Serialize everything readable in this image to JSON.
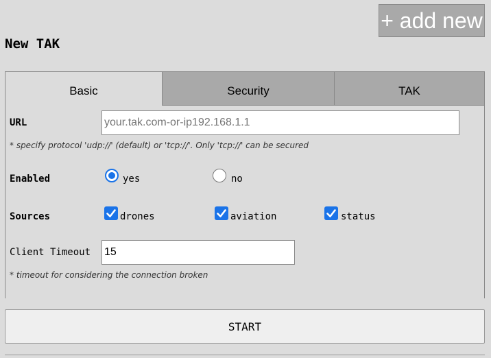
{
  "header": {
    "add_new_label": "+ add new",
    "title": "New TAK"
  },
  "tabs": [
    {
      "label": "Basic",
      "active": true
    },
    {
      "label": "Security",
      "active": false
    },
    {
      "label": "TAK",
      "active": false
    }
  ],
  "form": {
    "url": {
      "label": "URL",
      "placeholder": "your.tak.com-or-ip192.168.1.1",
      "value": "",
      "hint": "* specify protocol 'udp://' (default) or 'tcp://'. Only 'tcp://' can be secured"
    },
    "enabled": {
      "label": "Enabled",
      "options": [
        {
          "label": "yes",
          "checked": true
        },
        {
          "label": "no",
          "checked": false
        }
      ]
    },
    "sources": {
      "label": "Sources",
      "options": [
        {
          "label": "drones",
          "checked": true
        },
        {
          "label": "aviation",
          "checked": true
        },
        {
          "label": "status",
          "checked": true
        }
      ]
    },
    "client_timeout": {
      "label": "Client Timeout",
      "value": "15",
      "hint": "* timeout for considering the connection broken"
    }
  },
  "actions": {
    "start_label": "START"
  },
  "colors": {
    "accent": "#1a73e8",
    "inactive_tab": "#a9a9a9",
    "background": "#dcdcdc"
  }
}
